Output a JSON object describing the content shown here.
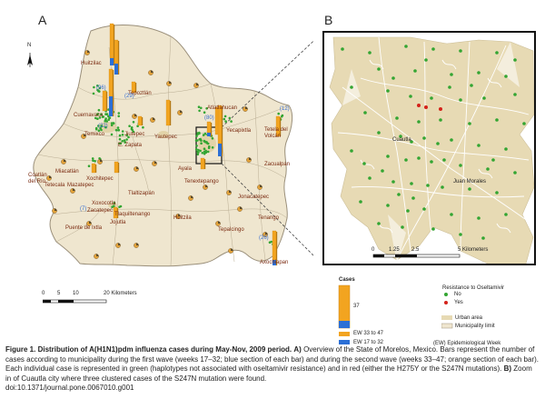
{
  "panels": {
    "a_letter": "A",
    "b_letter": "B"
  },
  "colors": {
    "land": "#efe6cf",
    "urban": "#e7dab4",
    "border": "#9a8f7a",
    "bar_orange": "#f2a420",
    "bar_blue": "#2b6fd6",
    "case_green": "#33a532",
    "case_red": "#d4221a",
    "label_brown": "#7a2a10",
    "count_blue": "#3a6fd0"
  },
  "north_arrow": {
    "label": "N",
    "icon": "north-arrow-icon"
  },
  "municipalities": [
    {
      "name": "Huitzilac"
    },
    {
      "name": "Tepoztlán"
    },
    {
      "name": "Cuernavaca"
    },
    {
      "name": "Temixco"
    },
    {
      "name": "Jiutepec"
    },
    {
      "name": "E. Zapata"
    },
    {
      "name": "Yautepec"
    },
    {
      "name": "Atlatlahucan"
    },
    {
      "name": "Yecapixtla"
    },
    {
      "name": "Tetela del Volcán"
    },
    {
      "name": "Coatlán del Río"
    },
    {
      "name": "Miacatlán"
    },
    {
      "name": "Tetecala"
    },
    {
      "name": "Mazatepec"
    },
    {
      "name": "Xochitepec"
    },
    {
      "name": "Ayala"
    },
    {
      "name": "Tenextepango"
    },
    {
      "name": "Zacualpan"
    },
    {
      "name": "Tlaltizapán"
    },
    {
      "name": "Jonacatepec"
    },
    {
      "name": "Xoxocotla"
    },
    {
      "name": "Zacatepec"
    },
    {
      "name": "Tlaquiltenango"
    },
    {
      "name": "Jojutla"
    },
    {
      "name": "Puente de Ixtla"
    },
    {
      "name": "Huitzila"
    },
    {
      "name": "Tepalcingo"
    },
    {
      "name": "Tenango"
    },
    {
      "name": "Axochiapan"
    }
  ],
  "case_counts": [
    "(96)",
    "(29)",
    "(22)",
    "(80)",
    "(12)",
    "(7)",
    "(26)"
  ],
  "scale_a": {
    "ticks": [
      "0",
      "5",
      "10",
      "20 Kilometers"
    ]
  },
  "scale_b": {
    "ticks": [
      "0",
      "1.25",
      "2.5",
      "5 Kilometers"
    ]
  },
  "town_b": {
    "cuautla": "Cuautla",
    "juan_morales": "Juan Morales"
  },
  "legend_cases": {
    "title": "Cases",
    "max_value": "37",
    "ew_33_47": "EW 33 to 47",
    "ew_17_32": "EW 17 to 32"
  },
  "legend_resistance": {
    "title": "Resistance to Oseltamivir",
    "no": "No",
    "yes": "Yes",
    "urban": "Urban area",
    "municipality": "Municipality limit",
    "ew_note": "(EW) Epidemiological Week"
  },
  "caption": {
    "bold_title": "Figure 1. Distribution of A(H1N1)pdm influenza cases during May-Nov, 2009 period.",
    "part_a_bold": "A)",
    "part_a": " Overview of the State of Morelos, Mexico. Bars represent the number of cases according to municipality during the first wave (weeks 17–32; blue section of each bar) and during the second wave (weeks 33–47; orange section of each bar). Each individual case is represented in green (haplotypes not associated with oseltamivir resistance) and in red (either the H275Y or the S247N mutations).",
    "part_b_bold": "B)",
    "part_b": " Zoom in of Cuautla city where three clustered cases of the S247N mutation were found.",
    "doi": "doi:10.1371/journal.pone.0067010.g001"
  }
}
